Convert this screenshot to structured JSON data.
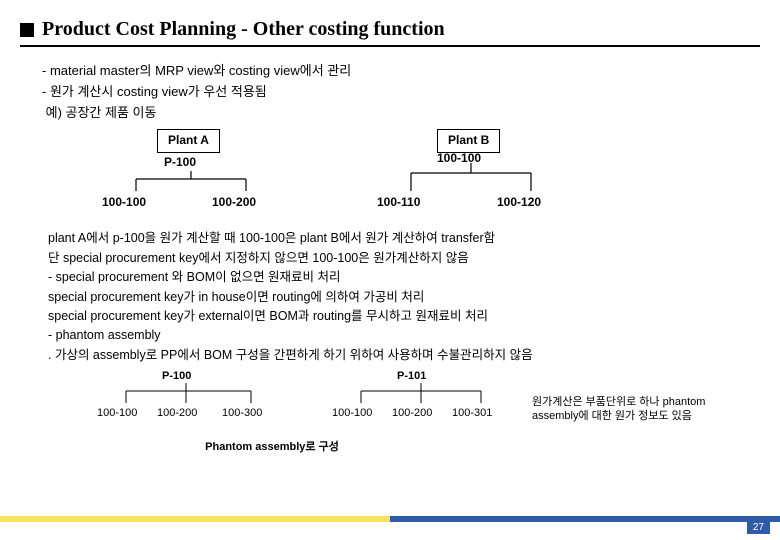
{
  "title": "Product Cost Planning - Other costing function",
  "bullets": {
    "b1": "- material master의 MRP view와 costing view에서 관리",
    "b2": "- 원가 계산시 costing view가 우선 적용됨",
    "b3": " 예) 공장간 제품 이동"
  },
  "tree1": {
    "plantA": "Plant A",
    "plantB": "Plant B",
    "p100": "P-100",
    "n100_100_a": "100-100",
    "n100_200": "100-200",
    "n100_100_b": "100-100",
    "n100_110": "100-110",
    "n100_120": "100-120"
  },
  "para": {
    "l1": "  plant A에서 p-100을 원가 계산할 때 100-100은 plant B에서 원가 계산하여 transfer함",
    "l2": "  단 special procurement key에서 지정하지 않으면 100-100은 원가계산하지 않음",
    "l3": "- special procurement 와 BOM이 없으면 원재료비 처리",
    "l4": "  special procurement key가 in house이면 routing에 의하여 가공비 처리",
    "l5": "  special procurement key가 external이면 BOM과 routing를 무시하고 원재료비 처리",
    "l6": "- phantom assembly",
    "l7": "  . 가상의 assembly로 PP에서 BOM 구성을 간편하게 하기 위하여 사용하며 수불관리하지 않음"
  },
  "tree2": {
    "p100": "P-100",
    "p101": "P-101",
    "a1": "100-100",
    "a2": "100-200",
    "a3": "100-300",
    "b1": "100-100",
    "b2": "100-200",
    "b3": "100-301",
    "note1": "원가계산은 부품단위로 하나 phantom",
    "note2": "assembly에 대한 원가 정보도 있음"
  },
  "phantom_footer": "Phantom assembly로 구성",
  "page": "27"
}
